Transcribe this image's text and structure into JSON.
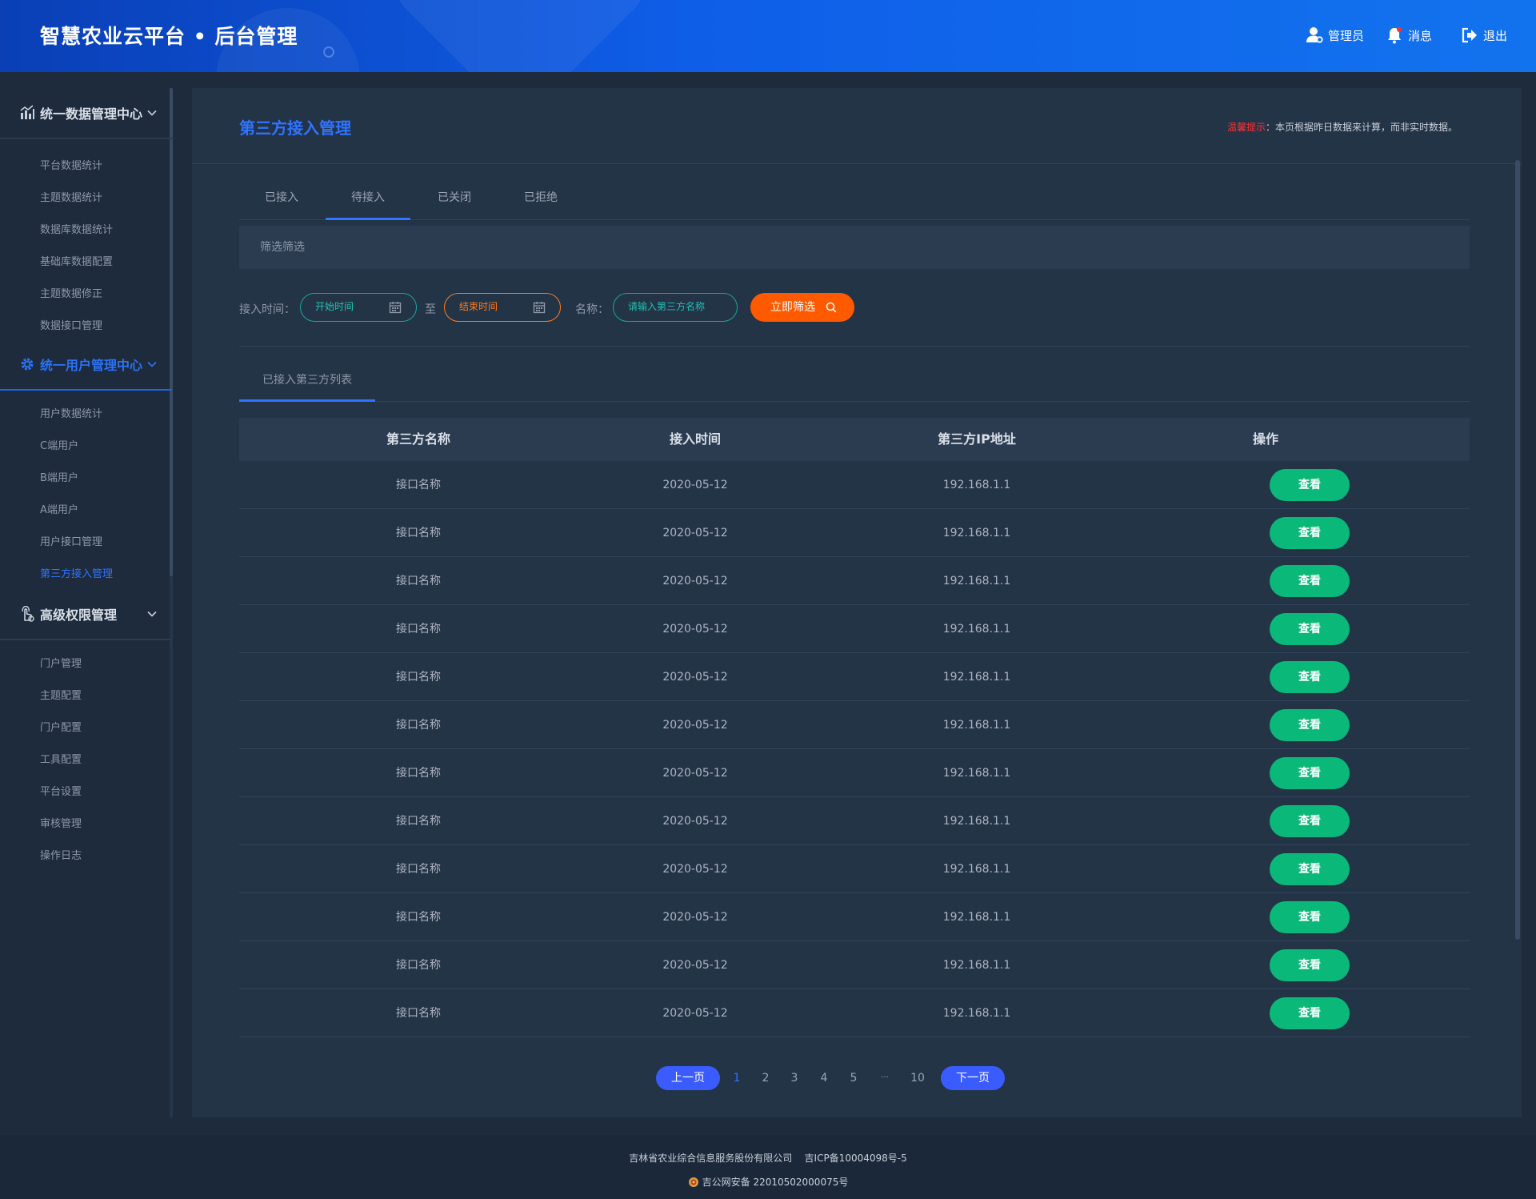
{
  "header": {
    "title": "智慧农业云平台 • 后台管理",
    "admin_label": "管理员",
    "messages_label": "消息",
    "logout_label": "退出"
  },
  "sidebar": {
    "groups": [
      {
        "title": "统一数据管理中心",
        "icon": "chart-icon",
        "items": [
          "平台数据统计",
          "主题数据统计",
          "数据库数据统计",
          "基础库数据配置",
          "主题数据修正",
          "数据接口管理"
        ]
      },
      {
        "title": "统一用户管理中心",
        "icon": "gear-icon",
        "items": [
          "用户数据统计",
          "C端用户",
          "B端用户",
          "A端用户",
          "用户接口管理",
          "第三方接入管理"
        ]
      },
      {
        "title": "高级权限管理",
        "icon": "touch-icon",
        "items": [
          "门户管理",
          "主题配置",
          "门户配置",
          "工具配置",
          "平台设置",
          "审核管理",
          "操作日志"
        ]
      }
    ],
    "active_item": "第三方接入管理"
  },
  "main": {
    "page_title": "第三方接入管理",
    "tip_label": "温馨提示",
    "tip_text": "：本页根据昨日数据来计算，而非实时数据。",
    "tabs": [
      "已接入",
      "待接入",
      "已关闭",
      "已拒绝"
    ],
    "active_tab": "待接入",
    "filter_bar_label": "筛选筛选",
    "filter": {
      "time_label": "接入时间：",
      "start_placeholder": "开始时间",
      "to_label": "至",
      "end_placeholder": "结束时间",
      "name_label": "名称：",
      "name_placeholder": "请输入第三方名称",
      "submit_label": "立即筛选"
    },
    "list_tab": "已接入第三方列表",
    "table": {
      "columns": [
        "第三方名称",
        "接入时间",
        "第三方IP地址",
        "操作"
      ],
      "rows": [
        {
          "name": "接口名称",
          "time": "2020-05-12",
          "ip": "192.168.1.1",
          "action": "查看"
        },
        {
          "name": "接口名称",
          "time": "2020-05-12",
          "ip": "192.168.1.1",
          "action": "查看"
        },
        {
          "name": "接口名称",
          "time": "2020-05-12",
          "ip": "192.168.1.1",
          "action": "查看"
        },
        {
          "name": "接口名称",
          "time": "2020-05-12",
          "ip": "192.168.1.1",
          "action": "查看"
        },
        {
          "name": "接口名称",
          "time": "2020-05-12",
          "ip": "192.168.1.1",
          "action": "查看"
        },
        {
          "name": "接口名称",
          "time": "2020-05-12",
          "ip": "192.168.1.1",
          "action": "查看"
        },
        {
          "name": "接口名称",
          "time": "2020-05-12",
          "ip": "192.168.1.1",
          "action": "查看"
        },
        {
          "name": "接口名称",
          "time": "2020-05-12",
          "ip": "192.168.1.1",
          "action": "查看"
        },
        {
          "name": "接口名称",
          "time": "2020-05-12",
          "ip": "192.168.1.1",
          "action": "查看"
        },
        {
          "name": "接口名称",
          "time": "2020-05-12",
          "ip": "192.168.1.1",
          "action": "查看"
        },
        {
          "name": "接口名称",
          "time": "2020-05-12",
          "ip": "192.168.1.1",
          "action": "查看"
        },
        {
          "name": "接口名称",
          "time": "2020-05-12",
          "ip": "192.168.1.1",
          "action": "查看"
        }
      ]
    },
    "pagination": {
      "prev_label": "上一页",
      "next_label": "下一页",
      "pages": [
        "1",
        "2",
        "3",
        "4",
        "5",
        "···",
        "10"
      ],
      "current": "1"
    }
  },
  "footer": {
    "company": "吉林省农业综合信息服务股份有限公司",
    "icp": "吉ICP备10004098号-5",
    "police": "吉公网安备 22010502000075号"
  },
  "colors": {
    "accent": "#2f73ff",
    "view_button": "#0ab87a",
    "filter_button": "#ff5a00",
    "start_input_border": "#1aa59a",
    "end_input_border": "#ff7a1a",
    "tip_red": "#ff3131"
  }
}
